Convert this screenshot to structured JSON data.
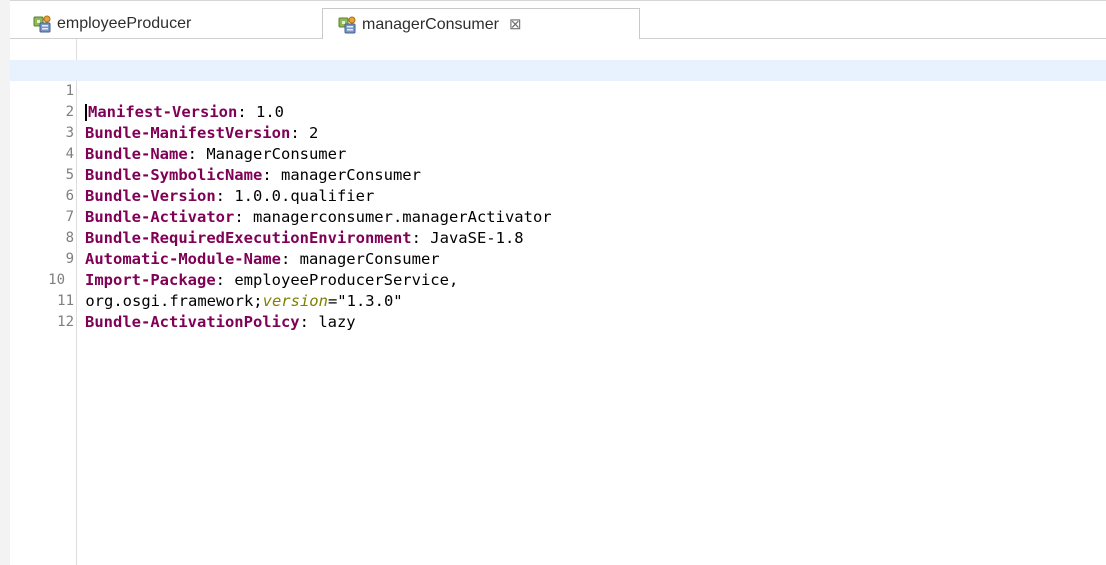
{
  "tabs": [
    {
      "label": "employeeProducer",
      "active": false,
      "icon": "manifest-icon"
    },
    {
      "label": "managerConsumer",
      "active": true,
      "icon": "manifest-icon",
      "close_icon": "⊠"
    }
  ],
  "editor": {
    "lines": [
      {
        "num": "1",
        "key": "Manifest-Version",
        "sep": ": ",
        "value": "1.0"
      },
      {
        "num": "2",
        "key": "Bundle-ManifestVersion",
        "sep": ": ",
        "value": "2"
      },
      {
        "num": "3",
        "key": "Bundle-Name",
        "sep": ": ",
        "value": "ManagerConsumer"
      },
      {
        "num": "4",
        "key": "Bundle-SymbolicName",
        "sep": ": ",
        "value": "managerConsumer"
      },
      {
        "num": "5",
        "key": "Bundle-Version",
        "sep": ": ",
        "value": "1.0.0.qualifier"
      },
      {
        "num": "6",
        "key": "Bundle-Activator",
        "sep": ": ",
        "value": "managerconsumer.managerActivator"
      },
      {
        "num": "7",
        "key": "Bundle-RequiredExecutionEnvironment",
        "sep": ": ",
        "value": "JavaSE-1.8"
      },
      {
        "num": "8",
        "key": "Automatic-Module-Name",
        "sep": ": ",
        "value": "managerConsumer"
      },
      {
        "num": "9",
        "key": "Import-Package",
        "sep": ": ",
        "value": "employeeProducerService,"
      },
      {
        "num": "10",
        "continuation": " org.osgi.framework;",
        "attr": "version",
        "attr_value": "=\"1.3.0\""
      },
      {
        "num": "11",
        "key": "Bundle-ActivationPolicy",
        "sep": ": ",
        "value": "lazy"
      },
      {
        "num": "12"
      }
    ]
  },
  "colors": {
    "keyword": "#7f0055",
    "attribute": "#808000",
    "current_line": "#e8f2fe",
    "line_number": "#7f7f7f"
  }
}
